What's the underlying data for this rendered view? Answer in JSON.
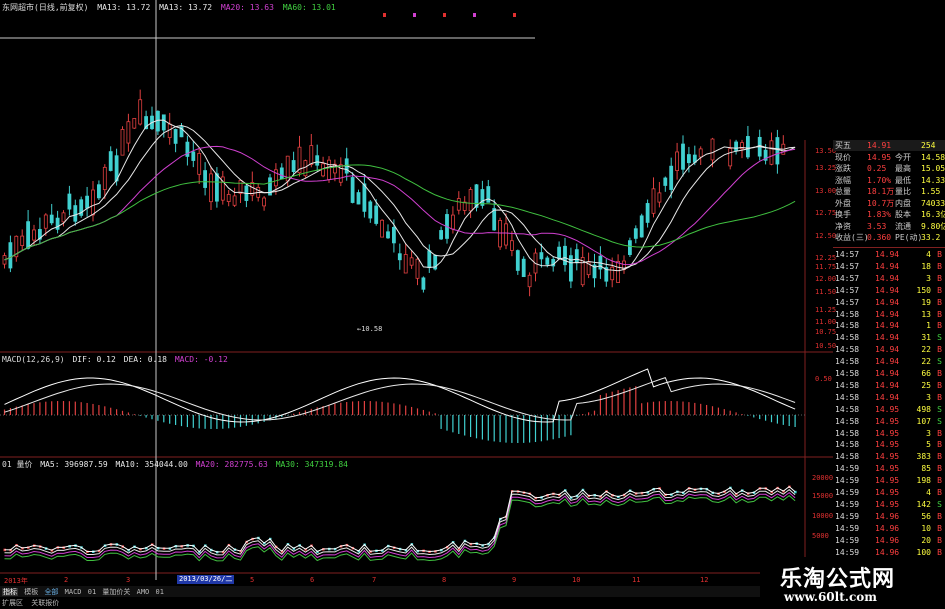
{
  "header": {
    "stock": "东网超市(日线,前复权)",
    "ma1": "MA13: 13.72",
    "ma2": "MA13: 13.72",
    "ma3": "MA20: 13.63",
    "ma4": "MA60: 13.01",
    "colors": {
      "ma1": "#e8e8e8",
      "ma2": "#e8e8e8",
      "ma3": "#d040d0",
      "ma4": "#40d040"
    }
  },
  "annotations": {
    "low_price": "←10.58"
  },
  "price_axis": [
    "13.50",
    "13.25",
    "13.00",
    "12.75",
    "12.50",
    "12.25",
    "12.00",
    "11.75",
    "11.50",
    "11.25",
    "11.00",
    "10.75",
    "10.50"
  ],
  "macd_header": {
    "name": "MACD(12,26,9)",
    "dif": "DIF: 0.12",
    "dea": "DEA: 0.18",
    "macd": "MACD: -0.12"
  },
  "macd_axis": [
    "0.50"
  ],
  "vol_header": {
    "name": "01 量价",
    "ma5": "MA5: 396987.59",
    "ma10": "MA10: 354044.00",
    "ma20": "MA20: 282775.63",
    "ma30": "MA30: 347319.84"
  },
  "vol_axis": [
    "20000",
    "15000",
    "10000",
    "5000"
  ],
  "x_axis": {
    "labels": [
      "2013年",
      "2",
      "3",
      "4",
      "5",
      "6",
      "7",
      "8",
      "9",
      "10",
      "11",
      "12"
    ],
    "cursor_date": "2013/03/26/二"
  },
  "bottom_tabs": {
    "row1": [
      "指标",
      "模板",
      "全部",
      "MACD",
      "01",
      "量加价关",
      "AMO",
      "01"
    ],
    "row2": [
      "扩展区",
      "关联报价"
    ]
  },
  "quote": [
    {
      "label": "买五",
      "value": "14.91",
      "label2": "",
      "value2": "254"
    },
    {
      "label": "现价",
      "value": "14.95",
      "label2": "今开",
      "value2": "14.58"
    },
    {
      "label": "涨跌",
      "value": "0.25",
      "label2": "最高",
      "value2": "15.05"
    },
    {
      "label": "涨幅",
      "value": "1.70%",
      "label2": "最低",
      "value2": "14.33"
    },
    {
      "label": "总量",
      "value": "18.1万",
      "label2": "量比",
      "value2": "1.55"
    },
    {
      "label": "外盘",
      "value": "10.7万",
      "label2": "内盘",
      "value2": "74033"
    },
    {
      "label": "换手",
      "value": "1.83%",
      "label2": "股本",
      "value2": "16.3亿"
    },
    {
      "label": "净资",
      "value": "3.53",
      "label2": "流通",
      "value2": "9.80亿"
    },
    {
      "label": "收益(三)",
      "value": "0.360",
      "label2": "PE(动)",
      "value2": "33.2"
    }
  ],
  "ticks": [
    {
      "time": "14:57",
      "price": "14.94",
      "vol": "4",
      "dir": "B"
    },
    {
      "time": "14:57",
      "price": "14.94",
      "vol": "18",
      "dir": "B"
    },
    {
      "time": "14:57",
      "price": "14.94",
      "vol": "3",
      "dir": "B"
    },
    {
      "time": "14:57",
      "price": "14.94",
      "vol": "150",
      "dir": "B"
    },
    {
      "time": "14:57",
      "price": "14.94",
      "vol": "19",
      "dir": "B"
    },
    {
      "time": "14:58",
      "price": "14.94",
      "vol": "13",
      "dir": "B"
    },
    {
      "time": "14:58",
      "price": "14.94",
      "vol": "1",
      "dir": "B"
    },
    {
      "time": "14:58",
      "price": "14.94",
      "vol": "31",
      "dir": "S"
    },
    {
      "time": "14:58",
      "price": "14.94",
      "vol": "22",
      "dir": "B"
    },
    {
      "time": "14:58",
      "price": "14.94",
      "vol": "22",
      "dir": "S"
    },
    {
      "time": "14:58",
      "price": "14.94",
      "vol": "66",
      "dir": "B"
    },
    {
      "time": "14:58",
      "price": "14.94",
      "vol": "25",
      "dir": "B"
    },
    {
      "time": "14:58",
      "price": "14.94",
      "vol": "3",
      "dir": "B"
    },
    {
      "time": "14:58",
      "price": "14.95",
      "vol": "498",
      "dir": "S"
    },
    {
      "time": "14:58",
      "price": "14.95",
      "vol": "107",
      "dir": "S"
    },
    {
      "time": "14:58",
      "price": "14.95",
      "vol": "3",
      "dir": "B"
    },
    {
      "time": "14:58",
      "price": "14.95",
      "vol": "5",
      "dir": "B"
    },
    {
      "time": "14:58",
      "price": "14.95",
      "vol": "383",
      "dir": "B"
    },
    {
      "time": "14:59",
      "price": "14.95",
      "vol": "85",
      "dir": "B"
    },
    {
      "time": "14:59",
      "price": "14.95",
      "vol": "198",
      "dir": "B"
    },
    {
      "time": "14:59",
      "price": "14.95",
      "vol": "4",
      "dir": "B"
    },
    {
      "time": "14:59",
      "price": "14.95",
      "vol": "142",
      "dir": "S"
    },
    {
      "time": "14:59",
      "price": "14.96",
      "vol": "56",
      "dir": "B"
    },
    {
      "time": "14:59",
      "price": "14.96",
      "vol": "10",
      "dir": "B"
    },
    {
      "time": "14:59",
      "price": "14.96",
      "vol": "20",
      "dir": "B"
    },
    {
      "time": "14:59",
      "price": "14.96",
      "vol": "100",
      "dir": "B"
    }
  ],
  "brand": {
    "name": "乐淘公式网",
    "url": "www.60lt.com"
  }
}
